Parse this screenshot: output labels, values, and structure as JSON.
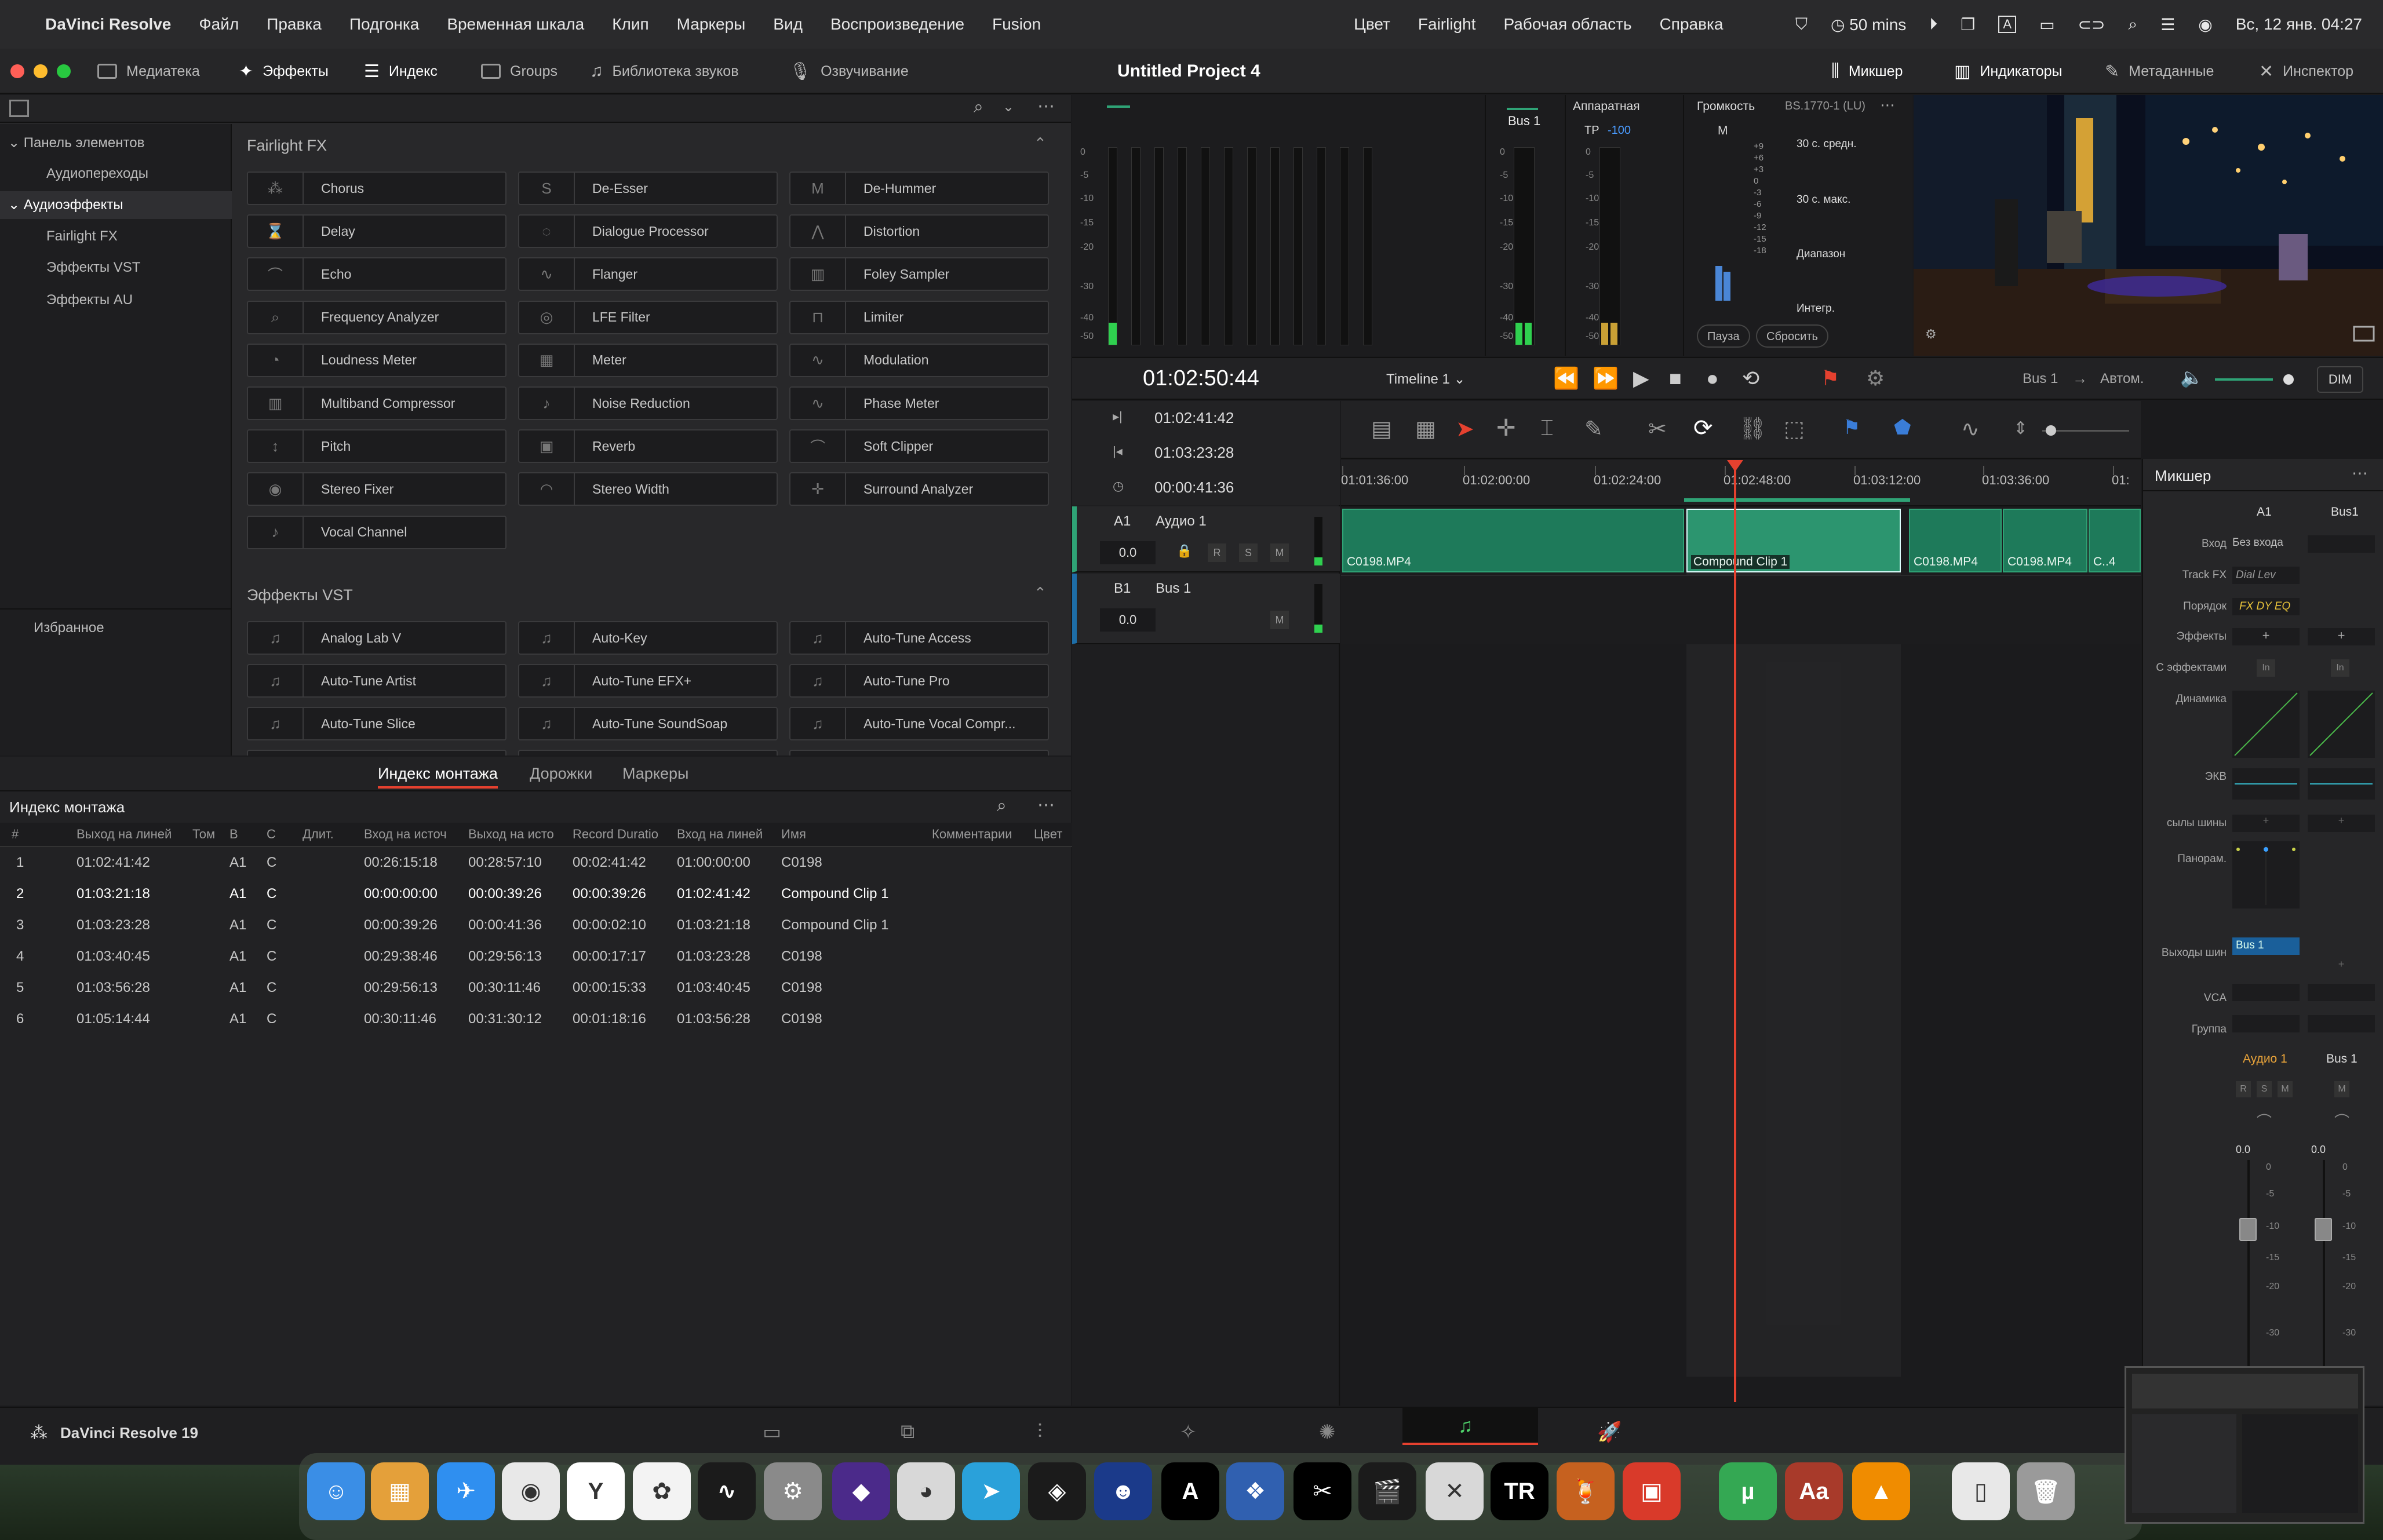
{
  "menubar": {
    "apple": "",
    "app_name": "DaVinci Resolve",
    "items": [
      "Файл",
      "Правка",
      "Подгонка",
      "Временная шкала",
      "Клип",
      "Маркеры",
      "Вид",
      "Воспроизведение",
      "Fusion",
      "Цвет",
      "Fairlight",
      "Рабочая область",
      "Справка"
    ],
    "timer": "50 mins",
    "input_label": "A",
    "datetime": "Вс, 12 янв.  04:27"
  },
  "toolbar": {
    "media": "Медиатека",
    "effects": "Эффекты",
    "index": "Индекс",
    "groups": "Groups",
    "sound_library": "Библиотека звуков",
    "voiceover": "Озвучивание",
    "project_title": "Untitled Project 4",
    "mixer": "Микшер",
    "meters": "Индикаторы",
    "metadata": "Метаданные",
    "inspector": "Инспектор"
  },
  "left_tree": {
    "toolbox": "Панель элементов",
    "audio_transitions": "Аудиопереходы",
    "audio_fx": "Аудиоэффекты",
    "fairlight_fx": "Fairlight FX",
    "vst": "Эффекты VST",
    "au": "Эффекты AU",
    "favorites": "Избранное"
  },
  "effects": {
    "section1": "Fairlight FX",
    "fairlight": [
      {
        "label": "Chorus",
        "icon": "chorus-icon"
      },
      {
        "label": "De-Esser",
        "icon": "de-esser-icon"
      },
      {
        "label": "De-Hummer",
        "icon": "de-hummer-icon"
      },
      {
        "label": "Delay",
        "icon": "delay-icon"
      },
      {
        "label": "Dialogue Processor",
        "icon": "dialogue-icon"
      },
      {
        "label": "Distortion",
        "icon": "distortion-icon"
      },
      {
        "label": "Echo",
        "icon": "echo-icon"
      },
      {
        "label": "Flanger",
        "icon": "flanger-icon"
      },
      {
        "label": "Foley Sampler",
        "icon": "foley-icon"
      },
      {
        "label": "Frequency Analyzer",
        "icon": "analyzer-icon"
      },
      {
        "label": "LFE Filter",
        "icon": "lfe-icon"
      },
      {
        "label": "Limiter",
        "icon": "limiter-icon"
      },
      {
        "label": "Loudness Meter",
        "icon": "loudness-icon"
      },
      {
        "label": "Meter",
        "icon": "meter-icon"
      },
      {
        "label": "Modulation",
        "icon": "modulation-icon"
      },
      {
        "label": "Multiband Compressor",
        "icon": "compressor-icon"
      },
      {
        "label": "Noise Reduction",
        "icon": "noise-icon"
      },
      {
        "label": "Phase Meter",
        "icon": "phase-icon"
      },
      {
        "label": "Pitch",
        "icon": "pitch-icon"
      },
      {
        "label": "Reverb",
        "icon": "reverb-icon"
      },
      {
        "label": "Soft Clipper",
        "icon": "clipper-icon"
      },
      {
        "label": "Stereo Fixer",
        "icon": "stereo-fixer-icon"
      },
      {
        "label": "Stereo Width",
        "icon": "stereo-width-icon"
      },
      {
        "label": "Surround Analyzer",
        "icon": "surround-icon"
      },
      {
        "label": "Vocal Channel",
        "icon": "vocal-icon"
      }
    ],
    "section2": "Эффекты VST",
    "vst": [
      {
        "label": "Analog Lab V"
      },
      {
        "label": "Auto-Key"
      },
      {
        "label": "Auto-Tune Access"
      },
      {
        "label": "Auto-Tune Artist"
      },
      {
        "label": "Auto-Tune EFX+"
      },
      {
        "label": "Auto-Tune Pro"
      },
      {
        "label": "Auto-Tune Slice"
      },
      {
        "label": "Auto-Tune SoundSoap"
      },
      {
        "label": "Auto-Tune Vocal Compr..."
      }
    ]
  },
  "index_panel": {
    "tabs": [
      "Индекс монтажа",
      "Дорожки",
      "Маркеры"
    ],
    "title": "Индекс монтажа",
    "columns": [
      "#",
      "Выход на линей",
      "Том",
      "В",
      "С",
      "Длит.",
      "Вход на источ",
      "Выход на исто",
      "Record Duratio",
      "Вход на линей",
      "Имя",
      "Комментарии",
      "Цвет"
    ],
    "rows": [
      [
        "1",
        "01:02:41:42",
        "",
        "A1",
        "C",
        "",
        "00:26:15:18",
        "00:28:57:10",
        "00:02:41:42",
        "01:00:00:00",
        "C0198"
      ],
      [
        "2",
        "01:03:21:18",
        "",
        "A1",
        "C",
        "",
        "00:00:00:00",
        "00:00:39:26",
        "00:00:39:26",
        "01:02:41:42",
        "Compound Clip 1"
      ],
      [
        "3",
        "01:03:23:28",
        "",
        "A1",
        "C",
        "",
        "00:00:39:26",
        "00:00:41:36",
        "00:00:02:10",
        "01:03:21:18",
        "Compound Clip 1"
      ],
      [
        "4",
        "01:03:40:45",
        "",
        "A1",
        "C",
        "",
        "00:29:38:46",
        "00:29:56:13",
        "00:00:17:17",
        "01:03:23:28",
        "C0198"
      ],
      [
        "5",
        "01:03:56:28",
        "",
        "A1",
        "C",
        "",
        "00:29:56:13",
        "00:30:11:46",
        "00:00:15:33",
        "01:03:40:45",
        "C0198"
      ],
      [
        "6",
        "01:05:14:44",
        "",
        "A1",
        "C",
        "",
        "00:30:11:46",
        "00:31:30:12",
        "00:01:18:16",
        "01:03:56:28",
        "C0198"
      ]
    ]
  },
  "meters": {
    "bus_label": "Bus 1",
    "scale": [
      "0",
      "-5",
      "-10",
      "-15",
      "-20",
      "-30",
      "-40",
      "-50"
    ],
    "hardware": "Аппаратная",
    "tp_label": "TP",
    "tp_value": "-100",
    "loudness": "Громкость",
    "standard": "BS.1770-1 (LU)",
    "m_label": "M",
    "short_term": "30 с. средн.",
    "short_max": "30 с. макс.",
    "range": "Диапазон",
    "integrated": "Интегр.",
    "pause": "Пауза",
    "reset": "Сбросить",
    "lu_scale": [
      "+9",
      "+6",
      "+3",
      "0",
      "-3",
      "-6",
      "-9",
      "-12",
      "-15",
      "-18"
    ]
  },
  "transport": {
    "timecode": "01:02:50:44",
    "timeline_name": "Timeline 1",
    "bus": "Bus 1",
    "arrow": "→",
    "auto": "Автом.",
    "dim": "DIM"
  },
  "timeline": {
    "in_tc": "01:02:41:42",
    "out_tc": "01:03:23:28",
    "dur_tc": "00:00:41:36",
    "ruler": [
      "01:01:36:00",
      "01:02:00:00",
      "01:02:24:00",
      "01:02:48:00",
      "01:03:12:00",
      "01:03:36:00",
      "01:"
    ],
    "track_a1_id": "A1",
    "track_a1_name": "Аудио 1",
    "track_a1_vol": "0.0",
    "track_b1_id": "B1",
    "track_b1_name": "Bus 1",
    "track_b1_vol": "0.0",
    "btn_r": "R",
    "btn_s": "S",
    "btn_m": "M",
    "clips": [
      "C0198.MP4",
      "Compound Clip 1",
      "C0198.MP4",
      "C0198.MP4",
      "C..4"
    ]
  },
  "mixer": {
    "title": "Микшер",
    "ch1": "A1",
    "ch2": "Bus1",
    "labels": [
      "Вход",
      "Track FX",
      "Порядок",
      "Эффекты",
      "С эффектами",
      "Динамика",
      "ЭКВ",
      "сылы шины",
      "Панорам.",
      "Выходы шин",
      "VCA",
      "Группа"
    ],
    "input_value": "Без входа",
    "track_fx": "Dial Lev",
    "order": "FX DY EQ",
    "plus": "+",
    "in": "In",
    "bus_out": "Bus 1",
    "name1": "Аудио 1",
    "name2": "Bus 1",
    "fader1": "0.0",
    "fader2": "0.0",
    "fader_scale": [
      "0",
      "-5",
      "-10",
      "-15",
      "-20",
      "-30"
    ]
  },
  "statusbar": {
    "app": "DaVinci Resolve 19"
  },
  "colors": {
    "accent_red": "#e5412f",
    "clip_green": "#1e7a5a",
    "playhead": "#e5412f"
  }
}
